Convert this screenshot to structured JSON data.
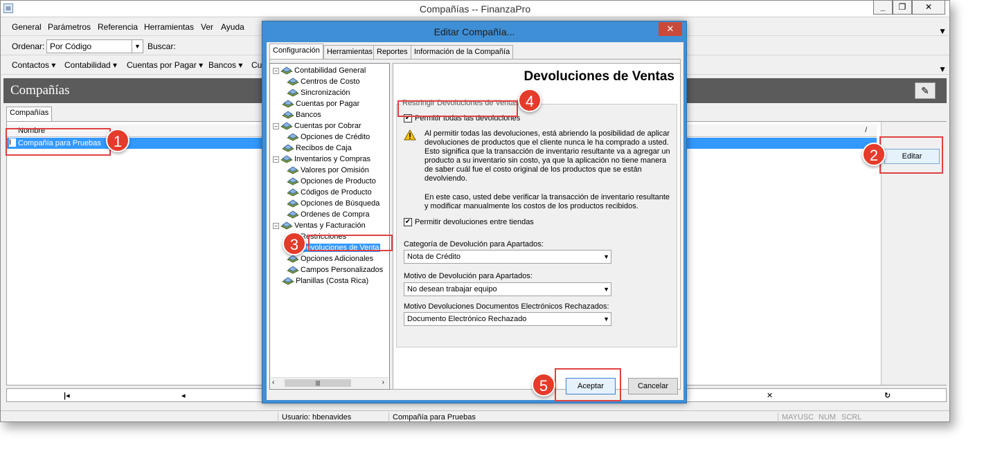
{
  "window": {
    "title": "Compañías -- FinanzaPro"
  },
  "menu": [
    "General",
    "Parámetros",
    "Referencia",
    "Herramientas",
    "Ver",
    "Ayuda"
  ],
  "sort": {
    "label": "Ordenar:",
    "value": "Por Código",
    "search_label": "Buscar:"
  },
  "modules": [
    "Contactos ▾",
    "Contabilidad ▾",
    "Cuentas por Pagar ▾",
    "Bancos ▾",
    "Cu"
  ],
  "panel": {
    "title": "Compañías",
    "tab": "Compañías"
  },
  "grid": {
    "column": "Nombre",
    "rows": [
      "Compañía para Pruebas"
    ]
  },
  "editar_button": "Editar",
  "nav": {
    "first": "|◂",
    "prev": "◂",
    "delete": "✕",
    "refresh": "↻"
  },
  "status": {
    "user": "Usuario: hbenavides",
    "company": "Compañía para Pruebas",
    "caps": "MAYUSC",
    "num": "NUM",
    "scrl": "SCRL"
  },
  "dialog": {
    "title": "Editar Compañía...",
    "tabs": [
      "Configuración",
      "Herramientas",
      "Reportes",
      "Información de la Compañía"
    ],
    "tree": [
      {
        "label": "Contabilidad General",
        "level": 0,
        "toggle": "−"
      },
      {
        "label": "Centros de Costo",
        "level": 1
      },
      {
        "label": "Sincronización",
        "level": 1
      },
      {
        "label": "Cuentas por Pagar",
        "level": 0
      },
      {
        "label": "Bancos",
        "level": 0
      },
      {
        "label": "Cuentas por Cobrar",
        "level": 0,
        "toggle": "−"
      },
      {
        "label": "Opciones de Crédito",
        "level": 1
      },
      {
        "label": "Recibos de Caja",
        "level": 0
      },
      {
        "label": "Inventarios y Compras",
        "level": 0,
        "toggle": "−"
      },
      {
        "label": "Valores por Omisión",
        "level": 1
      },
      {
        "label": "Opciones de Producto",
        "level": 1
      },
      {
        "label": "Códigos de Producto",
        "level": 1
      },
      {
        "label": "Opciones de Búsqueda",
        "level": 1
      },
      {
        "label": "Ordenes de Compra",
        "level": 1
      },
      {
        "label": "Ventas y Facturación",
        "level": 0,
        "toggle": "−"
      },
      {
        "label": "Restricciones",
        "level": 1
      },
      {
        "label": "Devoluciones de Venta",
        "level": 1,
        "selected": true
      },
      {
        "label": "Opciones Adicionales",
        "level": 1
      },
      {
        "label": "Campos Personalizados",
        "level": 1
      },
      {
        "label": "Planillas (Costa Rica)",
        "level": 0
      }
    ],
    "section_title": "Devoluciones de Ventas",
    "group_legend": "Restringir Devoluciones de Ventas",
    "chk_all": "Permitir todas las devoluciones",
    "warning_line1": "Al permitir todas las devoluciones, está abriendo la posibilidad de aplicar devoluciones de productos que el cliente nunca le ha comprado a usted. Esto significa que la transacción de inventario resultante va a agregar un producto a su inventario sin costo, ya que la aplicación no tiene manera de saber cuál fue el costo original de los productos que se están devolviendo.",
    "warning_line2": "En este caso, usted debe verificar la transacción de inventario resultante y modificar manualmente los costos de los productos recibidos.",
    "chk_stores": "Permitir devoluciones entre tiendas",
    "cat_label": "Categoría de Devolución para Apartados:",
    "cat_value": "Nota de Crédito",
    "motivo_label": "Motivo de Devolución para Apartados:",
    "motivo_value": "No desean trabajar equipo",
    "motivo_doc_label": "Motivo Devoluciones Documentos Electrónicos Rechazados:",
    "motivo_doc_value": "Documento Electrónico Rechazado",
    "accept": "Aceptar",
    "cancel": "Cancelar"
  },
  "annotations": [
    "1",
    "2",
    "3",
    "4",
    "5"
  ],
  "colors": {
    "accent": "#3399ff",
    "badge": "#e53b2a",
    "dialog_frame": "#3f8fd6",
    "header": "#5b5b5b"
  }
}
